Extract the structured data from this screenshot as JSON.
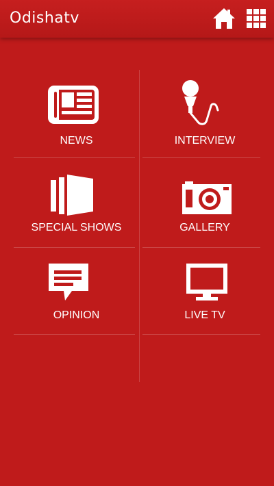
{
  "app": {
    "brand": "Odishatv"
  },
  "header": {
    "home_icon": "home-icon",
    "menu_icon": "grid-menu-icon"
  },
  "tiles": [
    {
      "label": "NEWS",
      "icon": "newspaper-icon"
    },
    {
      "label": "INTERVIEW",
      "icon": "microphone-icon"
    },
    {
      "label": "SPECIAL SHOWS",
      "icon": "panels-icon"
    },
    {
      "label": "GALLERY",
      "icon": "camera-icon"
    },
    {
      "label": "OPINION",
      "icon": "comment-icon"
    },
    {
      "label": "LIVE TV",
      "icon": "tv-icon"
    }
  ],
  "colors": {
    "background": "#bf1b1b",
    "text": "#ffffff"
  }
}
